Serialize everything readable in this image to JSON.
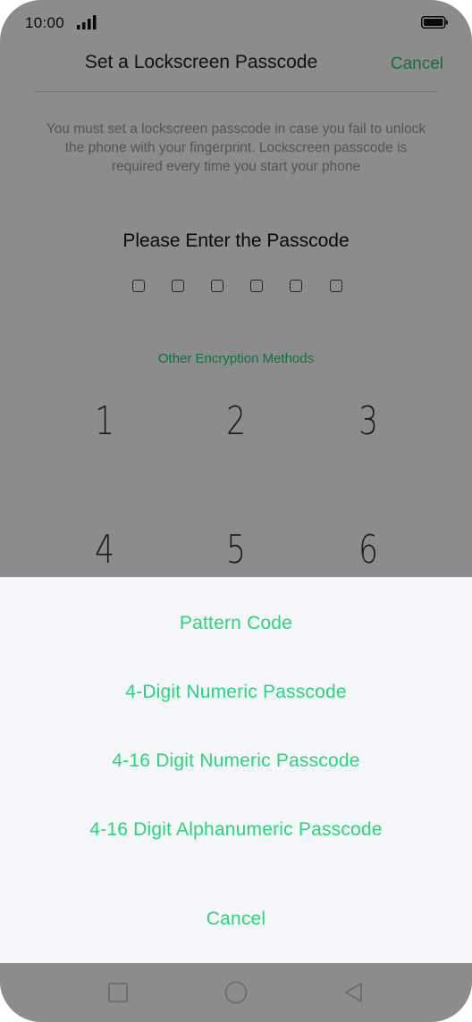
{
  "status": {
    "time": "10:00"
  },
  "header": {
    "title": "Set a Lockscreen Passcode",
    "cancel_label": "Cancel"
  },
  "description": "You must set a lockscreen passcode in case you fail to unlock the phone with your fingerprint. Lockscreen passcode is required every time you start your phone",
  "prompt": "Please Enter the Passcode",
  "other_methods_label": "Other Encryption Methods",
  "keypad": {
    "k1": "1",
    "k2": "2",
    "k3": "3",
    "k4": "4",
    "k5": "5",
    "k6": "6"
  },
  "sheet": {
    "options": [
      {
        "label": "Pattern Code"
      },
      {
        "label": "4-Digit Numeric Passcode"
      },
      {
        "label": "4-16 Digit Numeric Passcode"
      },
      {
        "label": "4-16 Digit Alphanumeric Passcode"
      }
    ],
    "cancel_label": "Cancel"
  },
  "colors": {
    "accent": "#1ed070",
    "overlay": "rgba(0,0,0,0.45)",
    "nav_bar": "#8c8c8c"
  },
  "icons": [
    "signal-icon",
    "battery-icon",
    "recents-square-icon",
    "home-circle-icon",
    "back-triangle-icon"
  ]
}
